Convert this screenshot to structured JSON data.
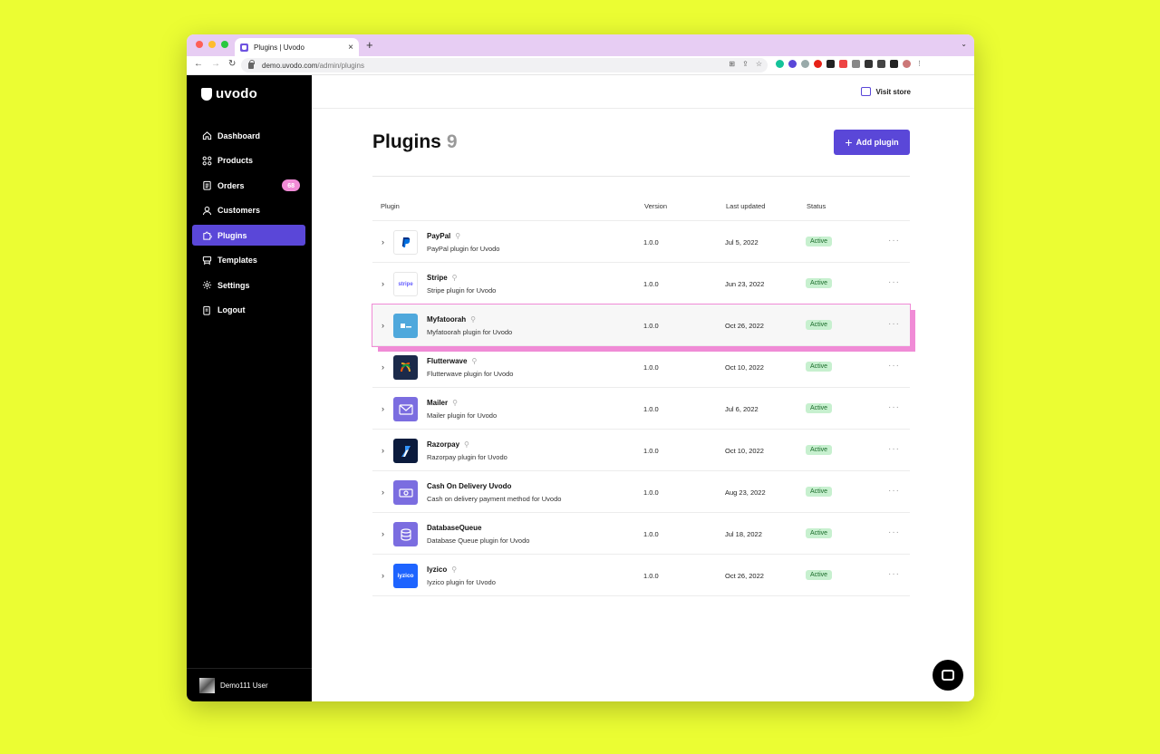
{
  "browser": {
    "tab_title": "Plugins | Uvodo",
    "tab_close": "×",
    "new_tab": "+",
    "url_host": "demo.uvodo.com",
    "url_path": "/admin/plugins"
  },
  "sidebar": {
    "brand": "uvodo",
    "items": [
      {
        "label": "Dashboard",
        "icon": "home-icon"
      },
      {
        "label": "Products",
        "icon": "grid-icon"
      },
      {
        "label": "Orders",
        "icon": "clipboard-icon",
        "badge": "68"
      },
      {
        "label": "Customers",
        "icon": "user-icon"
      },
      {
        "label": "Plugins",
        "icon": "puzzle-icon",
        "active": true
      },
      {
        "label": "Templates",
        "icon": "template-icon"
      },
      {
        "label": "Settings",
        "icon": "gear-icon"
      },
      {
        "label": "Logout",
        "icon": "logout-icon"
      }
    ],
    "user_name": "Demo111 User"
  },
  "header": {
    "visit_store": "Visit store"
  },
  "page": {
    "title": "Plugins",
    "count": "9",
    "add_button": "Add plugin"
  },
  "table": {
    "columns": [
      "Plugin",
      "Version",
      "Last updated",
      "Status"
    ],
    "rows": [
      {
        "name": "PayPal",
        "desc": "PayPal plugin for Uvodo",
        "version": "1.0.0",
        "updated": "Jul 5, 2022",
        "status": "Active"
      },
      {
        "name": "Stripe",
        "desc": "Stripe plugin for Uvodo",
        "version": "1.0.0",
        "updated": "Jun 23, 2022",
        "status": "Active",
        "logo_text": "stripe"
      },
      {
        "name": "Myfatoorah",
        "desc": "Myfatoorah plugin for Uvodo",
        "version": "1.0.0",
        "updated": "Oct 26, 2022",
        "status": "Active"
      },
      {
        "name": "Flutterwave",
        "desc": "Flutterwave plugin for Uvodo",
        "version": "1.0.0",
        "updated": "Oct 10, 2022",
        "status": "Active"
      },
      {
        "name": "Mailer",
        "desc": "Mailer plugin for Uvodo",
        "version": "1.0.0",
        "updated": "Jul 6, 2022",
        "status": "Active"
      },
      {
        "name": "Razorpay",
        "desc": "Razorpay plugin for Uvodo",
        "version": "1.0.0",
        "updated": "Oct 10, 2022",
        "status": "Active"
      },
      {
        "name": "Cash On Delivery Uvodo",
        "desc": "Cash on delivery payment method for Uvodo",
        "version": "1.0.0",
        "updated": "Aug 23, 2022",
        "status": "Active"
      },
      {
        "name": "DatabaseQueue",
        "desc": "Database Queue plugin for Uvodo",
        "version": "1.0.0",
        "updated": "Jul 18, 2022",
        "status": "Active"
      },
      {
        "name": "Iyzico",
        "desc": "Iyzico plugin for Uvodo",
        "version": "1.0.0",
        "updated": "Oct 26, 2022",
        "status": "Active",
        "logo_text": "iyzico"
      }
    ]
  },
  "colors": {
    "accent": "#5a47d8",
    "badge": "#f08bd6",
    "status_bg": "#c7f0cf",
    "page_bg": "#ebfd33"
  }
}
